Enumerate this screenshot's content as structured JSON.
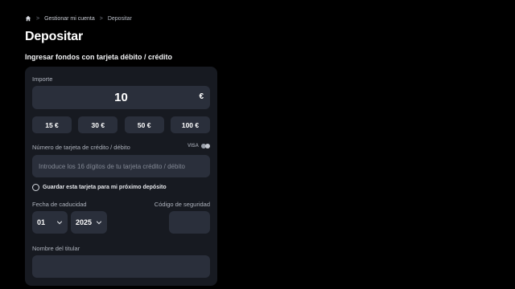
{
  "breadcrumb": {
    "home_icon": "home-icon",
    "items": [
      "Gestionar mi cuenta",
      "Depositar"
    ]
  },
  "page": {
    "title": "Depositar",
    "subtitle": "Ingresar fondos con tarjeta débito / crédito"
  },
  "deposit": {
    "amount_label": "Importe",
    "amount_value": "10",
    "currency": "€",
    "presets": [
      "15 €",
      "30 €",
      "50 €",
      "100 €"
    ],
    "card_number_label": "Número de tarjeta de crédito / débito",
    "card_brands": "VISA",
    "card_number_placeholder": "Introduce los 16 dígitos de tu tarjeta crédito / débito",
    "save_card_label": "Guardar esta tarjeta para mi próximo depósito",
    "expiry_label": "Fecha de caducidad",
    "expiry_month": "01",
    "expiry_year": "2025",
    "cvv_label": "Código de seguridad",
    "holder_label": "Nombre del titular"
  },
  "colors": {
    "background": "#000000",
    "card": "#171a21",
    "field": "#2a2f3b"
  }
}
